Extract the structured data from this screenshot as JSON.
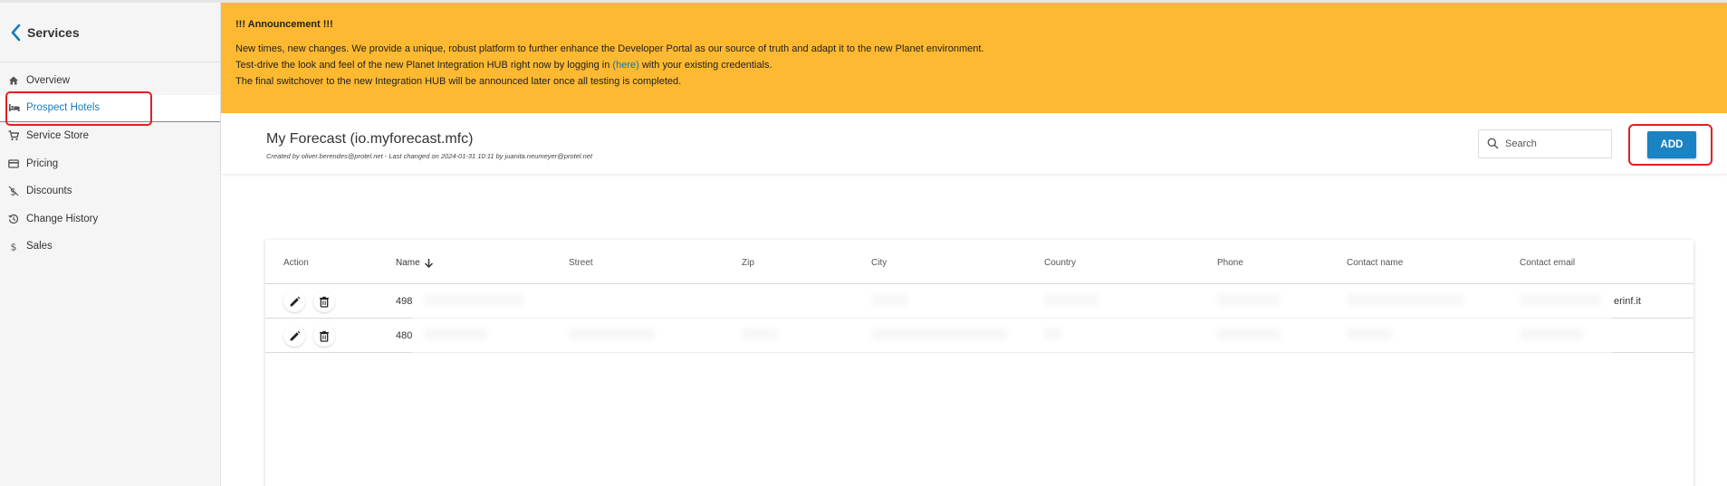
{
  "sidebar": {
    "title": "Services",
    "items": [
      {
        "label": "Overview",
        "icon": "home-icon"
      },
      {
        "label": "Prospect Hotels",
        "icon": "bed-icon",
        "active": true
      },
      {
        "label": "Service Store",
        "icon": "cart-icon"
      },
      {
        "label": "Pricing",
        "icon": "card-icon"
      },
      {
        "label": "Discounts",
        "icon": "discount-icon"
      },
      {
        "label": "Change History",
        "icon": "history-icon"
      },
      {
        "label": "Sales",
        "icon": "dollar-icon"
      }
    ]
  },
  "announcement": {
    "title": "!!! Announcement !!!",
    "line1": "New times, new changes. We provide a unique, robust platform to further enhance the Developer Portal as our source of truth and adapt it to the new Planet environment.",
    "line2_before": "Test-drive the look and feel of the new Planet Integration HUB right now by logging in ",
    "line2_link": "(here)",
    "line2_after": " with your existing credentials.",
    "line3": "The final switchover to the new Integration HUB will be announced later once all testing is completed.",
    "background": "#fdb931"
  },
  "header": {
    "title": "My Forecast (io.myforecast.mfc)",
    "meta": "Created by oliver.berendes@protel.net - Last changed on 2024-01-31 10:11 by juanita.neumeyer@protel.net",
    "search_placeholder": "Search",
    "add_label": "ADD"
  },
  "table": {
    "columns": [
      "Action",
      "Name",
      "Street",
      "Zip",
      "City",
      "Country",
      "Phone",
      "Contact name",
      "Contact email"
    ],
    "sorted_column": "Name",
    "sort_direction": "descending",
    "rows": [
      {
        "name": "498",
        "email_tail": "erinf.it"
      },
      {
        "name": "480",
        "email_tail": ""
      }
    ]
  },
  "colors": {
    "accent": "#1a83c4",
    "highlight": "#e02020",
    "active_nav": "#1a7ab8"
  }
}
